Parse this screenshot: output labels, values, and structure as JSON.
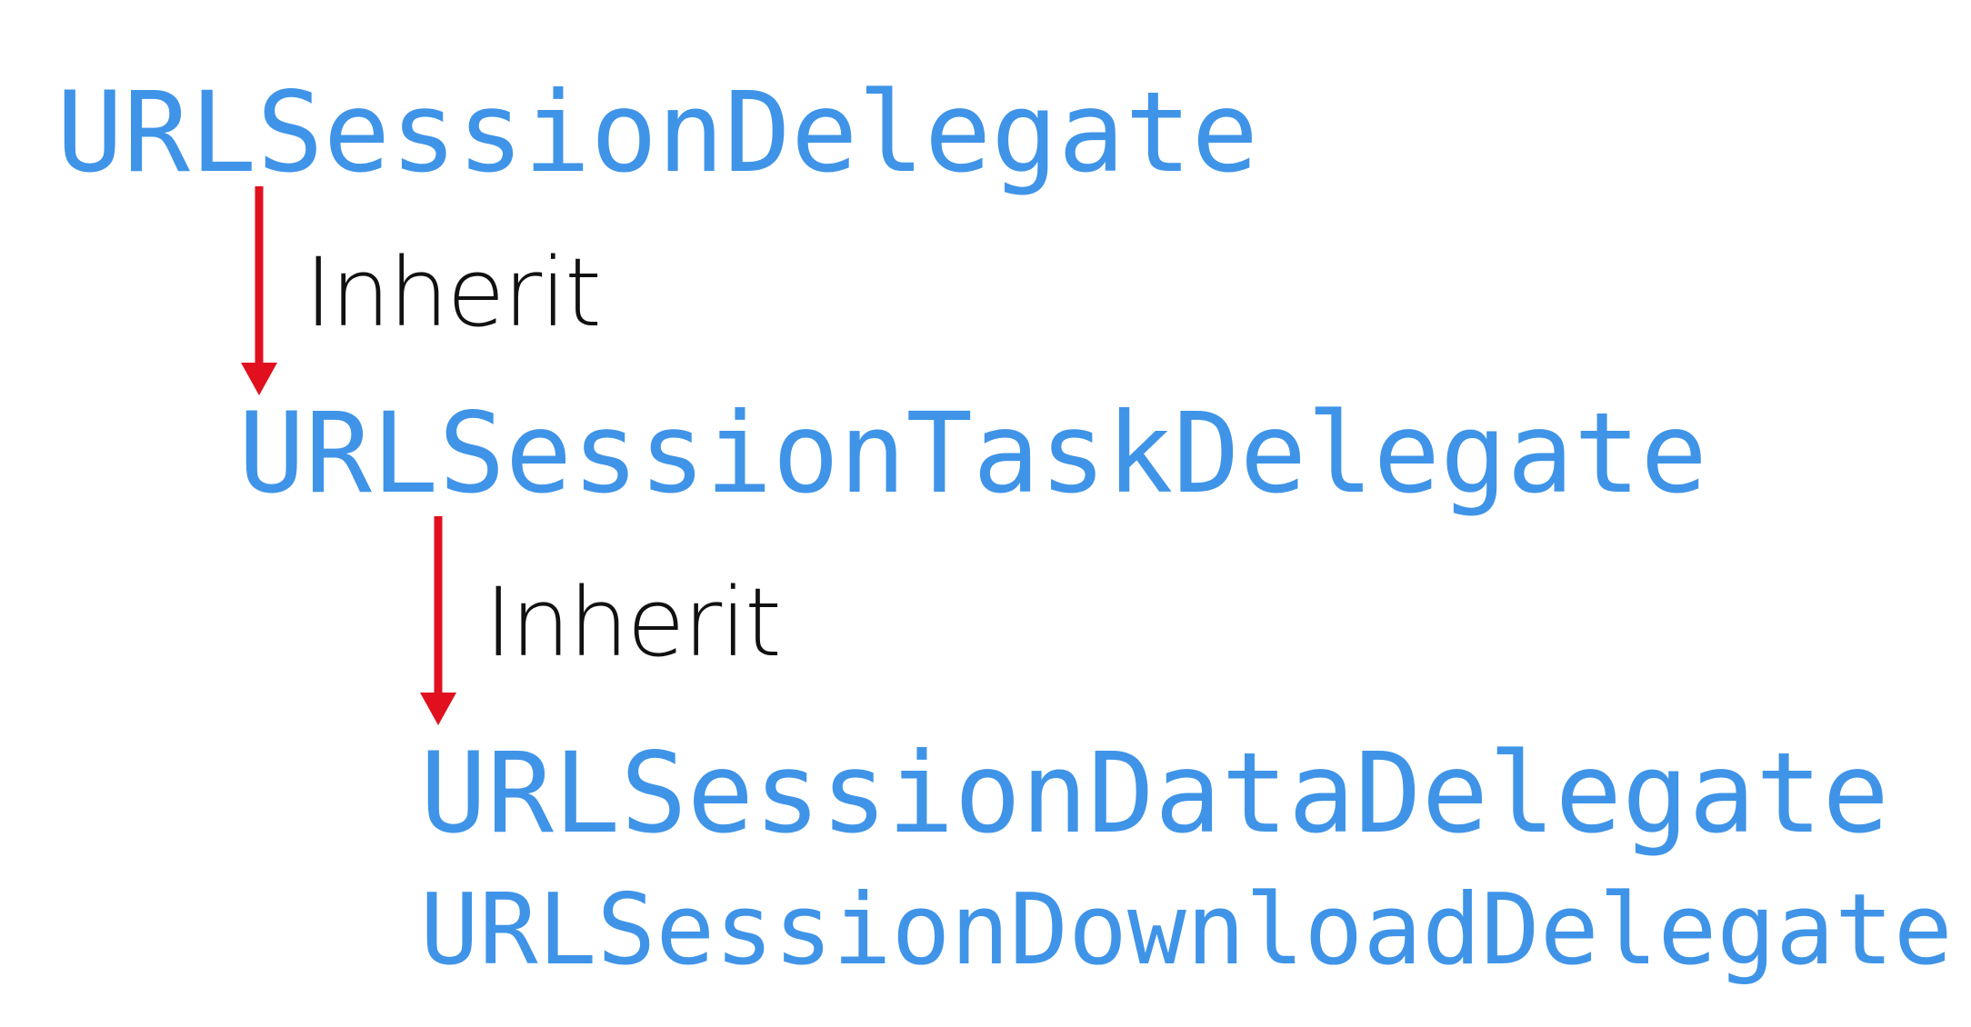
{
  "colors": {
    "type_text": "#3f94e8",
    "arrow": "#e0101e",
    "label_text": "#111111",
    "background": "#ffffff"
  },
  "diagram": {
    "nodes": [
      {
        "id": "url-session-delegate",
        "label": "URLSessionDelegate",
        "level": 0
      },
      {
        "id": "url-session-task-delegate",
        "label": "URLSessionTaskDelegate",
        "level": 1
      },
      {
        "id": "url-session-data-delegate",
        "label": "URLSessionDataDelegate",
        "level": 2
      },
      {
        "id": "url-session-download-delegate",
        "label": "URLSessionDownloadDelegate",
        "level": 2
      }
    ],
    "edges": [
      {
        "from": "url-session-delegate",
        "to": "url-session-task-delegate",
        "label": "Inherit"
      },
      {
        "from": "url-session-task-delegate",
        "to": "url-session-data-delegate",
        "label": "Inherit"
      }
    ]
  }
}
